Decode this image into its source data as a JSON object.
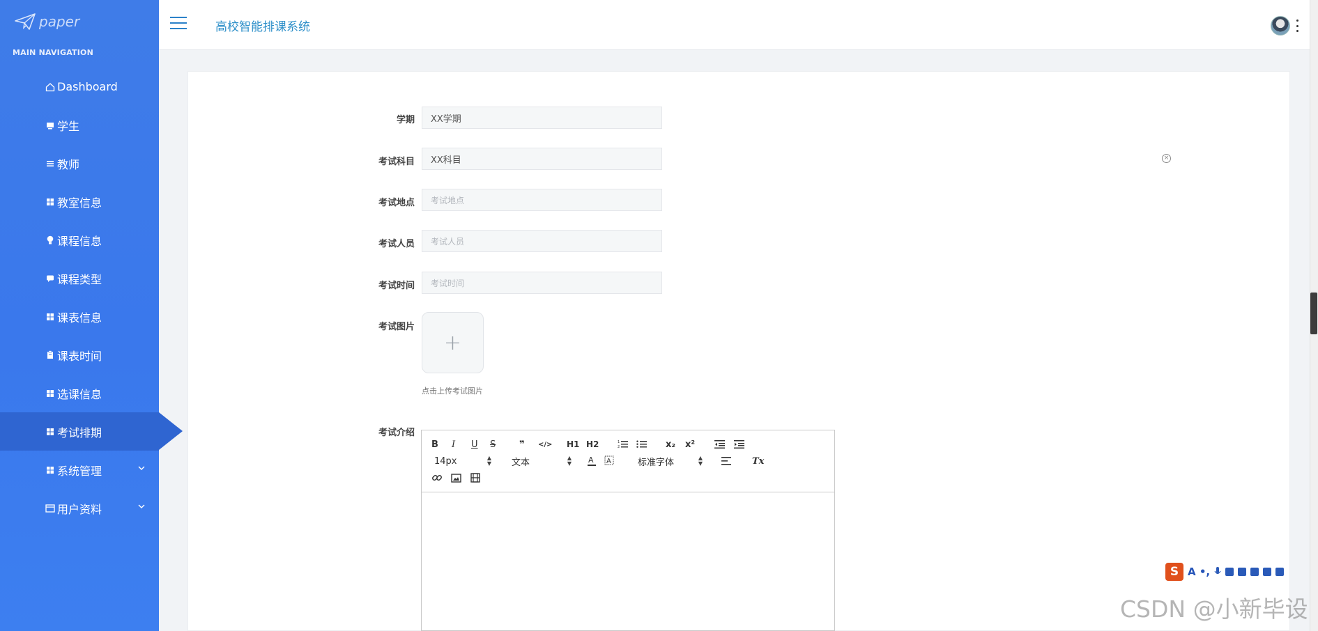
{
  "sidebar": {
    "logo_text": "paper",
    "nav_header": "MAIN NAVIGATION",
    "items": [
      {
        "label": "Dashboard",
        "icon": "home-icon"
      },
      {
        "label": "学生",
        "icon": "monitor-icon"
      },
      {
        "label": "教师",
        "icon": "list-icon"
      },
      {
        "label": "教室信息",
        "icon": "grid-icon"
      },
      {
        "label": "课程信息",
        "icon": "bulb-icon"
      },
      {
        "label": "课程类型",
        "icon": "chat-icon"
      },
      {
        "label": "课表信息",
        "icon": "grid-icon"
      },
      {
        "label": "课表时间",
        "icon": "clipboard-icon"
      },
      {
        "label": "选课信息",
        "icon": "grid-icon"
      },
      {
        "label": "考试排期",
        "icon": "grid-icon",
        "active": true
      },
      {
        "label": "系统管理",
        "icon": "grid-icon",
        "expandable": true
      },
      {
        "label": "用户资料",
        "icon": "window-icon",
        "expandable": true
      }
    ]
  },
  "header": {
    "title": "高校智能排课系统"
  },
  "form": {
    "fields": [
      {
        "label": "学期",
        "value": "XX学期",
        "placeholder": ""
      },
      {
        "label": "考试科目",
        "value": "XX科目",
        "placeholder": ""
      },
      {
        "label": "考试地点",
        "value": "",
        "placeholder": "考试地点"
      },
      {
        "label": "考试人员",
        "value": "",
        "placeholder": "考试人员"
      },
      {
        "label": "考试时间",
        "value": "",
        "placeholder": "考试时间"
      }
    ],
    "image_label": "考试图片",
    "upload_plus": "+",
    "upload_hint": "点击上传考试图片",
    "intro_label": "考试介绍"
  },
  "editor": {
    "buttons": [
      "B",
      "I",
      "U",
      "S",
      "❞",
      "</>",
      "H1",
      "H2",
      "ol",
      "ul",
      "x₂",
      "x²",
      "outdent",
      "indent"
    ],
    "font_size": "14px",
    "block_type": "文本",
    "font_family": "标准字体",
    "clear_format": "Tx"
  },
  "ime": {
    "logo": "S",
    "glyphs": "A •, "
  },
  "watermark": "CSDN @小新毕设",
  "colors": {
    "sidebar": "#3a78ec",
    "sidebar_active": "#2f65d1",
    "title": "#2d8fc9",
    "ime": "#e0501c"
  }
}
